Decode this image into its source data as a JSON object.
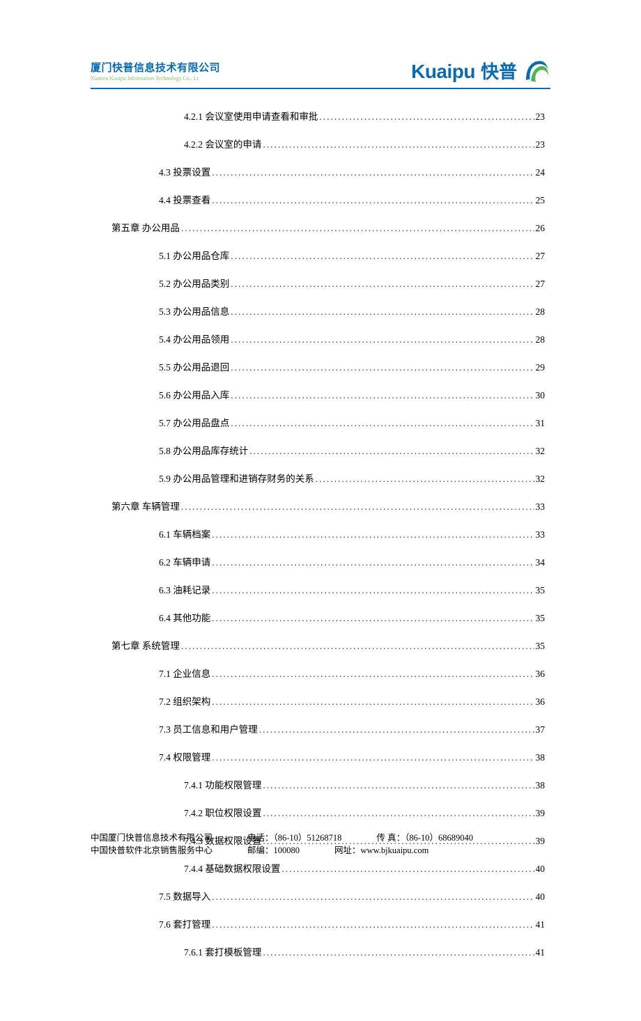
{
  "header": {
    "company_cn": "厦门快普信息技术有限公司",
    "company_en": "Xiamen Kuaipu Information Technology Co., Lt",
    "brand_en": "Kuaipu",
    "brand_cn": "快普"
  },
  "toc": [
    {
      "level": "sub",
      "label": "4.2.1 会议室使用申请查看和审批",
      "page": "23"
    },
    {
      "level": "sub",
      "label": "4.2.2 会议室的申请",
      "page": "23"
    },
    {
      "level": "section",
      "label": "4.3 投票设置",
      "page": "24"
    },
    {
      "level": "section",
      "label": "4.4 投票查看",
      "page": "25"
    },
    {
      "level": "chapter",
      "label": "第五章  办公用品",
      "page": "26"
    },
    {
      "level": "section",
      "label": "5.1 办公用品仓库",
      "page": "27"
    },
    {
      "level": "section",
      "label": "5.2 办公用品类别",
      "page": "27"
    },
    {
      "level": "section",
      "label": "5.3 办公用品信息",
      "page": "28"
    },
    {
      "level": "section",
      "label": "5.4 办公用品领用",
      "page": "28"
    },
    {
      "level": "section",
      "label": "5.5 办公用品退回",
      "page": "29"
    },
    {
      "level": "section",
      "label": "5.6 办公用品入库",
      "page": "30"
    },
    {
      "level": "section",
      "label": "5.7 办公用品盘点",
      "page": "31"
    },
    {
      "level": "section",
      "label": "5.8 办公用品库存统计",
      "page": "32"
    },
    {
      "level": "section",
      "label": "5.9 办公用品管理和进销存财务的关系",
      "page": "32"
    },
    {
      "level": "chapter",
      "label": "第六章  车辆管理",
      "page": "33"
    },
    {
      "level": "section",
      "label": "6.1 车辆档案",
      "page": "33"
    },
    {
      "level": "section",
      "label": "6.2 车辆申请",
      "page": "34"
    },
    {
      "level": "section",
      "label": "6.3 油耗记录",
      "page": "35"
    },
    {
      "level": "section",
      "label": "6.4 其他功能",
      "page": "35"
    },
    {
      "level": "chapter",
      "label": "第七章  系统管理",
      "page": "35"
    },
    {
      "level": "section",
      "label": "7.1 企业信息",
      "page": "36"
    },
    {
      "level": "section",
      "label": "7.2 组织架构",
      "page": "36"
    },
    {
      "level": "section",
      "label": "7.3 员工信息和用户管理",
      "page": "37"
    },
    {
      "level": "section",
      "label": "7.4  权限管理",
      "page": "38"
    },
    {
      "level": "sub",
      "label": "7.4.1 功能权限管理",
      "page": "38"
    },
    {
      "level": "sub",
      "label": "7.4.2 职位权限设置",
      "page": "39"
    },
    {
      "level": "sub",
      "label": "7.4.3 数据权限设置",
      "page": "39"
    },
    {
      "level": "sub",
      "label": "7.4.4 基础数据权限设置",
      "page": "40"
    },
    {
      "level": "section",
      "label": "7.5 数据导入",
      "page": "40"
    },
    {
      "level": "section",
      "label": "7.6 套打管理",
      "page": "41"
    },
    {
      "level": "sub",
      "label": "7.6.1  套打模板管理",
      "page": "41"
    }
  ],
  "footer": {
    "line1_company": "中国厦门快普信息技术有限公司",
    "line1_phone": "电话：（86-10）51268718",
    "line1_fax": "传  真：（86-10）68689040",
    "line2_company": "中国快普软件北京销售服务中心",
    "line2_zip": "邮编：100080",
    "line2_web": "网址：www.bjkuaipu.com"
  }
}
